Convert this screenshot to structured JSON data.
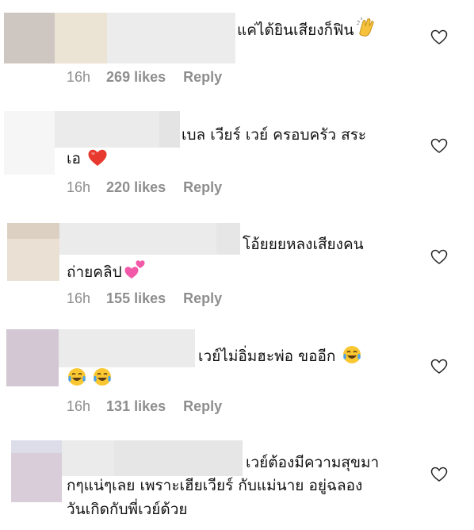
{
  "comments": [
    {
      "line1": "แค่ได้ยินเสียงก็ฟิน",
      "line2": "",
      "time": "16h",
      "likes": "269 likes",
      "reply": "Reply",
      "emoji_line1": [
        "clapping-hands"
      ],
      "emoji_line2": []
    },
    {
      "line1": "เบล เวียร์ เวย์ ครอบครัว สระ",
      "line2": "เอ",
      "time": "16h",
      "likes": "220 likes",
      "reply": "Reply",
      "emoji_line1": [],
      "emoji_line2": [
        "red-heart"
      ]
    },
    {
      "line1": "โอ้ยยยหลงเสียงคน",
      "line2": "ถ่ายคลิป",
      "time": "16h",
      "likes": "155 likes",
      "reply": "Reply",
      "emoji_line1": [],
      "emoji_line2": [
        "two-hearts"
      ]
    },
    {
      "line1": "เวย์ไม่อิ่มฮะพ่อ ขออีก",
      "line2": "",
      "time": "16h",
      "likes": "131 likes",
      "reply": "Reply",
      "emoji_line1": [
        "tears-of-joy"
      ],
      "emoji_line2": [
        "tears-of-joy",
        "tears-of-joy"
      ]
    },
    {
      "line1": "เวย์ต้องมีความสุขมา",
      "line2": "กๆแน่ๆเลย เพราะเฮียเวียร์ กับแม่นาย อยู่ฉลอง",
      "line3": "วันเกิดกับพี่เวย์ด้วย",
      "emoji_line1": [],
      "emoji_line2": []
    }
  ],
  "colors": {
    "meta_gray": "#8e8e8e",
    "text": "#111111",
    "heart_outline": "#262626"
  }
}
